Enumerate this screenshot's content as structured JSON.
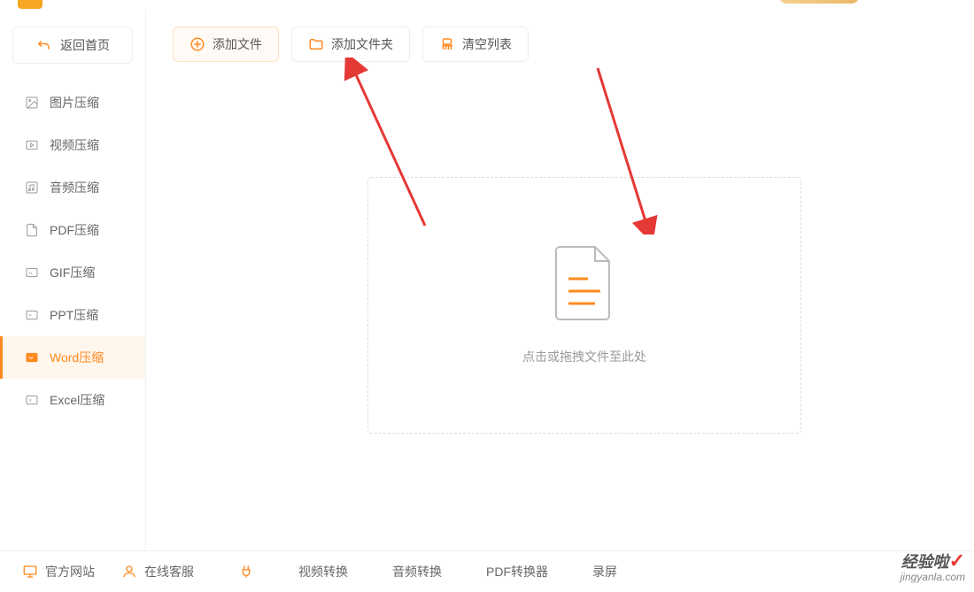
{
  "header": {
    "return_label": "返回首页"
  },
  "sidebar": {
    "items": [
      {
        "label": "图片压缩",
        "icon": "image-icon"
      },
      {
        "label": "视频压缩",
        "icon": "video-icon"
      },
      {
        "label": "音频压缩",
        "icon": "audio-icon"
      },
      {
        "label": "PDF压缩",
        "icon": "pdf-icon"
      },
      {
        "label": "GIF压缩",
        "icon": "gif-icon"
      },
      {
        "label": "PPT压缩",
        "icon": "ppt-icon"
      },
      {
        "label": "Word压缩",
        "icon": "word-icon"
      },
      {
        "label": "Excel压缩",
        "icon": "excel-icon"
      }
    ],
    "active_index": 6
  },
  "toolbar": {
    "add_file_label": "添加文件",
    "add_folder_label": "添加文件夹",
    "clear_list_label": "清空列表"
  },
  "dropzone": {
    "hint": "点击或拖拽文件至此处"
  },
  "footer": {
    "official_site": "官方网站",
    "online_service": "在线客服",
    "video_convert": "视频转换",
    "audio_convert": "音频转换",
    "pdf_converter": "PDF转换器",
    "screen_record": "录屏"
  },
  "watermark": {
    "title": "经验啦",
    "url": "jingyanla.com"
  }
}
